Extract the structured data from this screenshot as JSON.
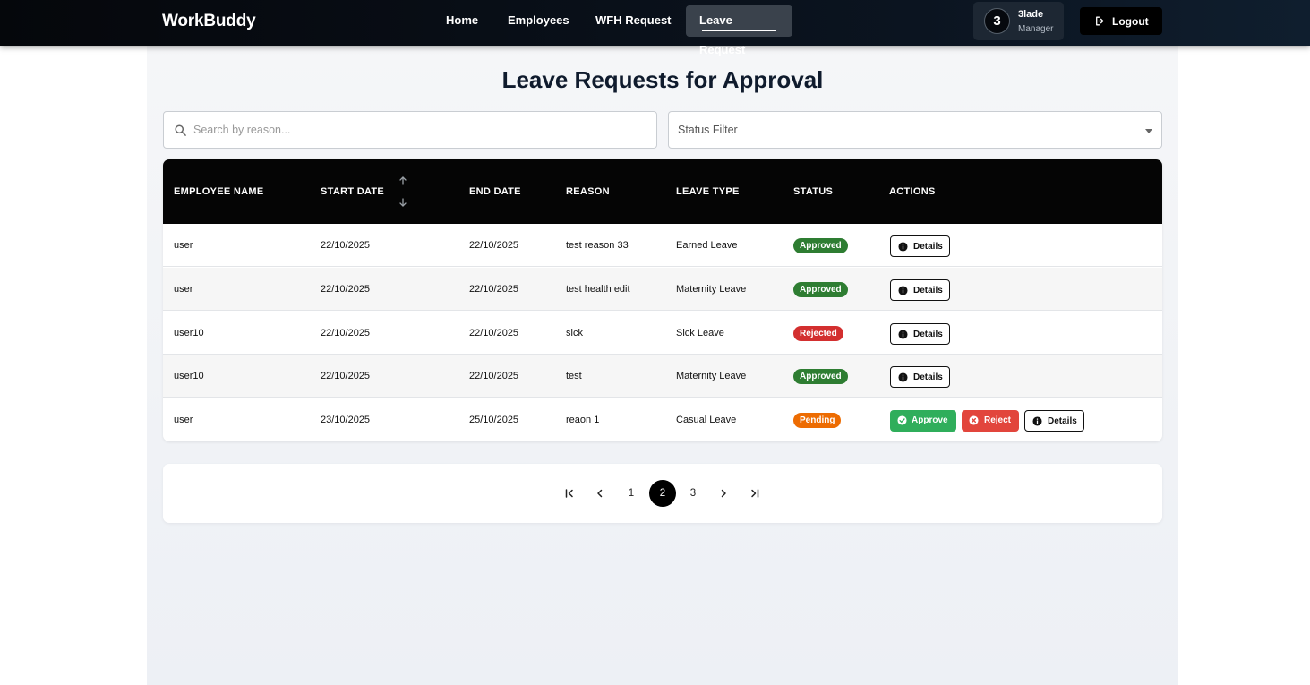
{
  "app": {
    "brand": "WorkBuddy"
  },
  "nav": {
    "items": [
      {
        "label": "Home"
      },
      {
        "label": "Employees"
      },
      {
        "label": "WFH Request"
      },
      {
        "label": "Leave Request",
        "active": true
      }
    ]
  },
  "user": {
    "initial": "3",
    "name": "3lade",
    "role": "Manager"
  },
  "logout": {
    "label": "Logout"
  },
  "page": {
    "title": "Leave Requests for Approval"
  },
  "search": {
    "placeholder": "Search by reason...",
    "value": ""
  },
  "status_filter": {
    "label": "Status Filter"
  },
  "table": {
    "headers": [
      "EMPLOYEE NAME",
      "START DATE",
      "END DATE",
      "REASON",
      "LEAVE TYPE",
      "STATUS",
      "ACTIONS"
    ],
    "rows": [
      {
        "employee": "user",
        "start": "22/10/2025",
        "end": "22/10/2025",
        "reason": "test reason 33",
        "type": "Earned Leave",
        "status": "Approved"
      },
      {
        "employee": "user",
        "start": "22/10/2025",
        "end": "22/10/2025",
        "reason": "test health edit",
        "type": "Maternity Leave",
        "status": "Approved"
      },
      {
        "employee": "user10",
        "start": "22/10/2025",
        "end": "22/10/2025",
        "reason": "sick",
        "type": "Sick Leave",
        "status": "Rejected"
      },
      {
        "employee": "user10",
        "start": "22/10/2025",
        "end": "22/10/2025",
        "reason": "test",
        "type": "Maternity Leave",
        "status": "Approved"
      },
      {
        "employee": "user",
        "start": "23/10/2025",
        "end": "25/10/2025",
        "reason": "reaon 1",
        "type": "Casual Leave",
        "status": "Pending"
      }
    ],
    "actions": {
      "approve": "Approve",
      "reject": "Reject",
      "details": "Details"
    }
  },
  "pagination": {
    "pages": [
      "1",
      "2",
      "3"
    ],
    "current": "2"
  },
  "colors": {
    "approved": "#2e7d32",
    "rejected": "#d32f2f",
    "pending": "#ed6c02",
    "approve_button": "#2fae5b",
    "reject_button": "#e2453c"
  },
  "icons": {
    "search": "search-icon",
    "logout": "logout-icon",
    "sort": "sort-arrows-icon",
    "details": "info-icon",
    "approve": "check-circle-icon",
    "reject": "x-circle-icon"
  }
}
